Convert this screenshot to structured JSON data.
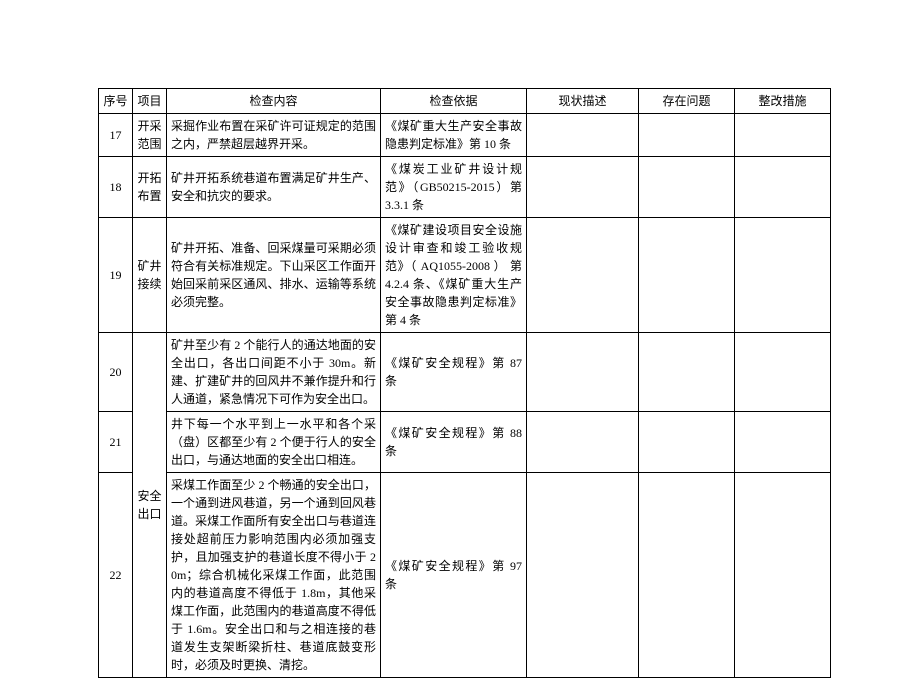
{
  "headers": {
    "seq": "序号",
    "item": "项目",
    "content": "检查内容",
    "basis": "检查依据",
    "status": "现状描述",
    "issue": "存在问题",
    "measure": "整改措施"
  },
  "rows": [
    {
      "seq": "17",
      "item": "开采范围",
      "content": "采掘作业布置在采矿许可证规定的范围之内，严禁超层越界开采。",
      "basis": "《煤矿重大生产安全事故隐患判定标准》第 10 条"
    },
    {
      "seq": "18",
      "item": "开拓布置",
      "content": "矿井开拓系统巷道布置满足矿井生产、安全和抗灾的要求。",
      "basis": "《煤炭工业矿井设计规范》（GB50215-2015）第 3.3.1 条"
    },
    {
      "seq": "19",
      "item": "矿井接续",
      "content": "矿井开拓、准备、回采煤量可采期必须符合有关标准规定。下山采区工作面开始回采前采区通风、排水、运输等系统必须完整。",
      "basis": "《煤矿建设项目安全设施设计审查和竣工验收规范》（ AQ1055-2008 ） 第 4.2.4 条、《煤矿重大生产安全事故隐患判定标准》第 4 条"
    },
    {
      "seq": "20",
      "group": "安全出口",
      "content": "矿井至少有 2 个能行人的通达地面的安全出口，各出口间距不小于 30m。新建、扩建矿井的回风井不兼作提升和行人通道，紧急情况下可作为安全出口。",
      "basis": "《煤矿安全规程》第 87 条"
    },
    {
      "seq": "21",
      "content": "井下每一个水平到上一水平和各个采（盘）区都至少有 2 个便于行人的安全出口，与通达地面的安全出口相连。",
      "basis": "《煤矿安全规程》第 88 条"
    },
    {
      "seq": "22",
      "content": "采煤工作面至少 2 个畅通的安全出口，一个通到进风巷道，另一个通到回风巷道。采煤工作面所有安全出口与巷道连接处超前压力影响范围内必须加强支护，且加强支护的巷道长度不得小于 20m；综合机械化采煤工作面，此范围内的巷道高度不得低于 1.8m，其他采煤工作面，此范围内的巷道高度不得低于 1.6m。安全出口和与之相连接的巷道发生支架断梁折柱、巷道底鼓变形时，必须及时更换、清挖。",
      "basis": "《煤矿安全规程》第 97 条"
    }
  ]
}
